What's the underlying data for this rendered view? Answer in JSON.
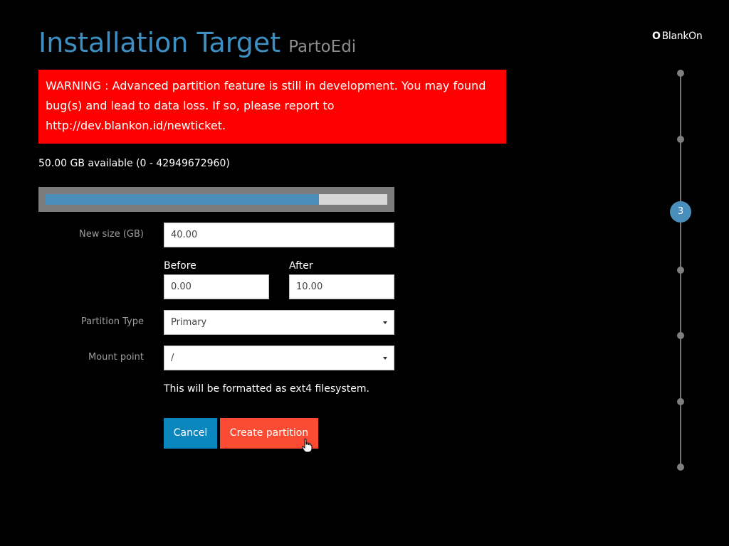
{
  "header": {
    "title": "Installation Target",
    "subtitle": "PartoEdi",
    "logo_mark": "O",
    "logo_text": "BlankOn"
  },
  "warning": {
    "text": "WARNING : Advanced partition feature is still in development. You may found bug(s) and lead to data loss. If so, please report to http://dev.blankon.id/newticket."
  },
  "disk": {
    "available_text": "50.00 GB available (0 - 42949672960)",
    "used_fraction": 0.8
  },
  "form": {
    "new_size_label": "New size (GB)",
    "new_size_value": "40.00",
    "before_label": "Before",
    "before_value": "0.00",
    "after_label": "After",
    "after_value": "10.00",
    "partition_type_label": "Partition Type",
    "partition_type_value": "Primary",
    "mount_point_label": "Mount point",
    "mount_point_value": "/",
    "format_note": "This will be formatted as ext4 filesystem."
  },
  "actions": {
    "cancel_label": "Cancel",
    "create_label": "Create partition"
  },
  "stepper": {
    "active_step": "3",
    "total_steps": 7
  },
  "colors": {
    "accent": "#3d8fc2",
    "warning_bg": "#ff0000",
    "cancel_bg": "#0b87bd",
    "create_bg": "#fb4c33",
    "progress_fill": "#4a8ebc"
  }
}
